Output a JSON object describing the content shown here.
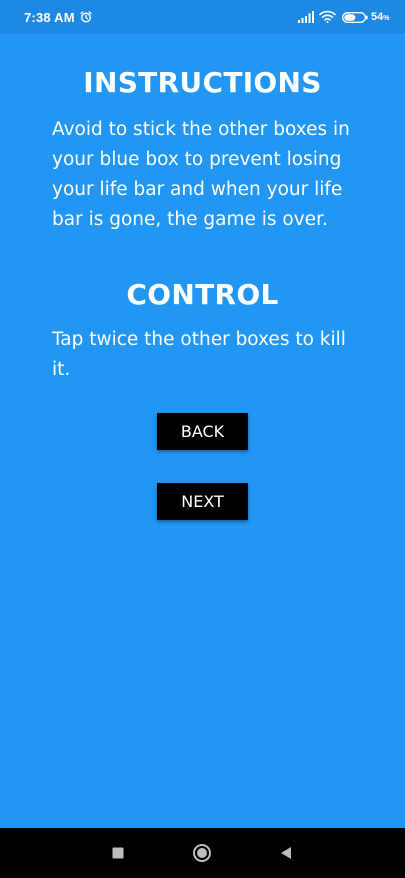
{
  "status_bar": {
    "time": "7:38 AM",
    "battery_level": "54",
    "battery_unit": "%",
    "icons": [
      "alarm-icon",
      "signal-icon",
      "wifi-icon",
      "battery-icon"
    ]
  },
  "instructions": {
    "title": "INSTRUCTIONS",
    "body": "Avoid to stick the other boxes in your blue box to prevent losing your life bar and when your life bar is gone, the game is over."
  },
  "control": {
    "title": "CONTROL",
    "body": "Tap twice the other boxes to kill it."
  },
  "buttons": {
    "back_label": "BACK",
    "next_label": "NEXT"
  },
  "nav_bar": {
    "icons": [
      "recent-apps-icon",
      "home-icon",
      "back-icon"
    ]
  },
  "colors": {
    "background": "#2196F3",
    "status_bar": "#1E88E5",
    "button": "#000000",
    "text": "#FFFFFF"
  }
}
